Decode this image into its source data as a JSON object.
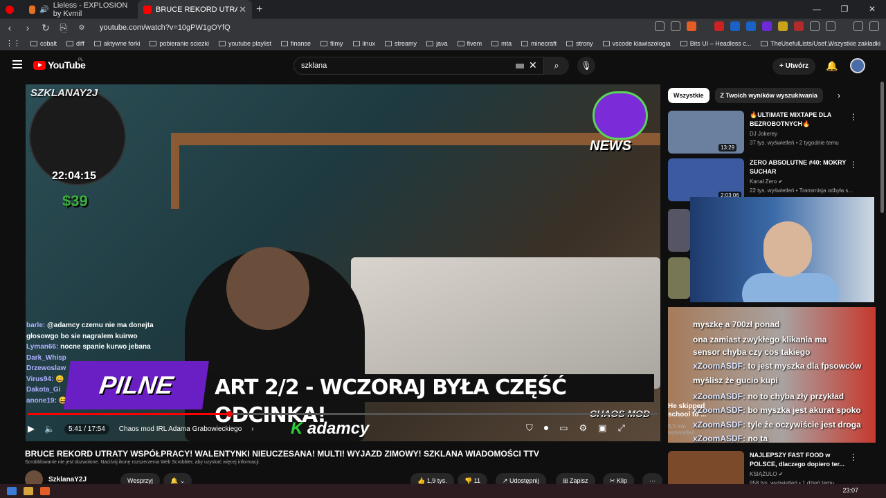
{
  "browser": {
    "tabs": [
      {
        "label": "Lieless - EXPLOSION by Kvmil"
      },
      {
        "label": "BRUCE REKORD UTRATY WSPÓŁ"
      }
    ],
    "url": "youtube.com/watch?v=10gPW1gOYfQ",
    "bookmarks": [
      "cobalt",
      "diff",
      "aktywne forki",
      "pobieranie sciezki",
      "youtube playlist",
      "finanse",
      "filmy",
      "linux",
      "streamy",
      "java",
      "fivem",
      "mta",
      "minecraft",
      "strony",
      "vscode klawiszologia",
      "Bits UI – Headless c...",
      "TheUsefulLists/Usef..."
    ],
    "bookmarks_other": "Wszystkie zakładki"
  },
  "header": {
    "logo": "YouTube",
    "region": "PL",
    "search_value": "szklana",
    "create_label": "Utwórz"
  },
  "video": {
    "overlay": {
      "minimap_title": "SZKLANAY2J",
      "clock": "22:04:15",
      "money": "$39",
      "brand": "NEWS",
      "pilne": "PILNE",
      "banner": "ART 2/2 - WCZORAJ BYŁA CZĘŚĆ ODCINKA!",
      "kadamcy_k": "K",
      "kadamcy_text": "adamcy",
      "chaos": "CHAOS MOD"
    },
    "chat": [
      {
        "user": "barle:",
        "msg": "@adamcy czemu nie ma donejta"
      },
      {
        "user": "",
        "msg": "głosowgo bo sie nagralem kuirwo"
      },
      {
        "user": "Lyman66:",
        "msg": "nocne spanie kurwo jebana"
      },
      {
        "user": "Dark_Whisp",
        "msg": ""
      },
      {
        "user": "Drzewoslaw",
        "msg": ""
      },
      {
        "user": "Virus94:",
        "msg": "😄"
      },
      {
        "user": "Dakota_Gi",
        "msg": ""
      },
      {
        "user": "anone19:",
        "msg": "😄"
      }
    ],
    "time": "5:41 / 17:54",
    "chapter": "Chaos mod IRL Adama Grabowieckiego",
    "progress": 0.32,
    "title": "BRUCE REKORD UTRATY WSPÓŁPRACY! WALENTYNKI NIEUCZESANA! MULTI! WYJAZD ZIMOWY! SZKLANA WIADOMOŚCI TTV",
    "scrobble": "Scrobblowanie nie jest dozwolone. Naciśnij ikonę rozszerzenia Web Scrobbler, aby uzyskać więcej informacji.",
    "channel": "SzklanaY2J",
    "support": "Wesprzyj",
    "likes": "1,9 tys.",
    "dislikes": "11",
    "share": "Udostępnij",
    "save": "Zapisz",
    "clip": "Klip"
  },
  "sidebar": {
    "chips": [
      "Wszystkie",
      "Z Twoich wyników wyszukiwania"
    ],
    "recs": [
      {
        "title": "🔥ULTIMATE MIXTAPE DLA BEZROBOTNYCH🔥",
        "channel": "DJ Jokerey",
        "meta": "37 tys. wyświetleń • 2 tygodnie temu",
        "duration": "13:29",
        "color": "#6b7f9e"
      },
      {
        "title": "ZERO ABSOLUTNE #40: MOKRY SUCHAR",
        "channel": "Kanał Zero ✔",
        "meta": "22 tys. wyświetleń • Transmisja odbyła s...",
        "duration": "2:03:06",
        "color": "#3b5aa0"
      },
      {
        "title": "NAJLEPSZY FAST FOOD w POLSCE, dlaczego dopiero ter...",
        "channel": "KSIĄŻULO ✔",
        "meta": "958 tys. wyświetleń • 1 dzień temu",
        "duration": "",
        "color": "#7a4a2a"
      }
    ],
    "stream_chat": [
      {
        "name": "",
        "msg": "myszkę a 700zł ponad"
      },
      {
        "name": "",
        "msg": "ona zamiast zwykłego klikania ma"
      },
      {
        "name": "",
        "msg": "sensor chyba czy cos takiego"
      },
      {
        "name": "xZoomASDF:",
        "msg": "to jest myszka dla fpsowców"
      },
      {
        "name": "",
        "msg": "myślisz że gucio kupi"
      },
      {
        "name": "xZoomASDF:",
        "msg": "no to chyba zły przykład"
      },
      {
        "name": "xZoomASDF:",
        "msg": "bo myszka jest akurat spoko"
      },
      {
        "name": "xZoomASDF:",
        "msg": "tyle że oczywiście jest droga"
      },
      {
        "name": "xZoomASDF:",
        "msg": "no ta"
      }
    ],
    "hidden_title": "He skipped school to ...",
    "hidden_meta": "6,5 mln wyświetleń"
  },
  "taskbar": {
    "clock": "23:07"
  }
}
